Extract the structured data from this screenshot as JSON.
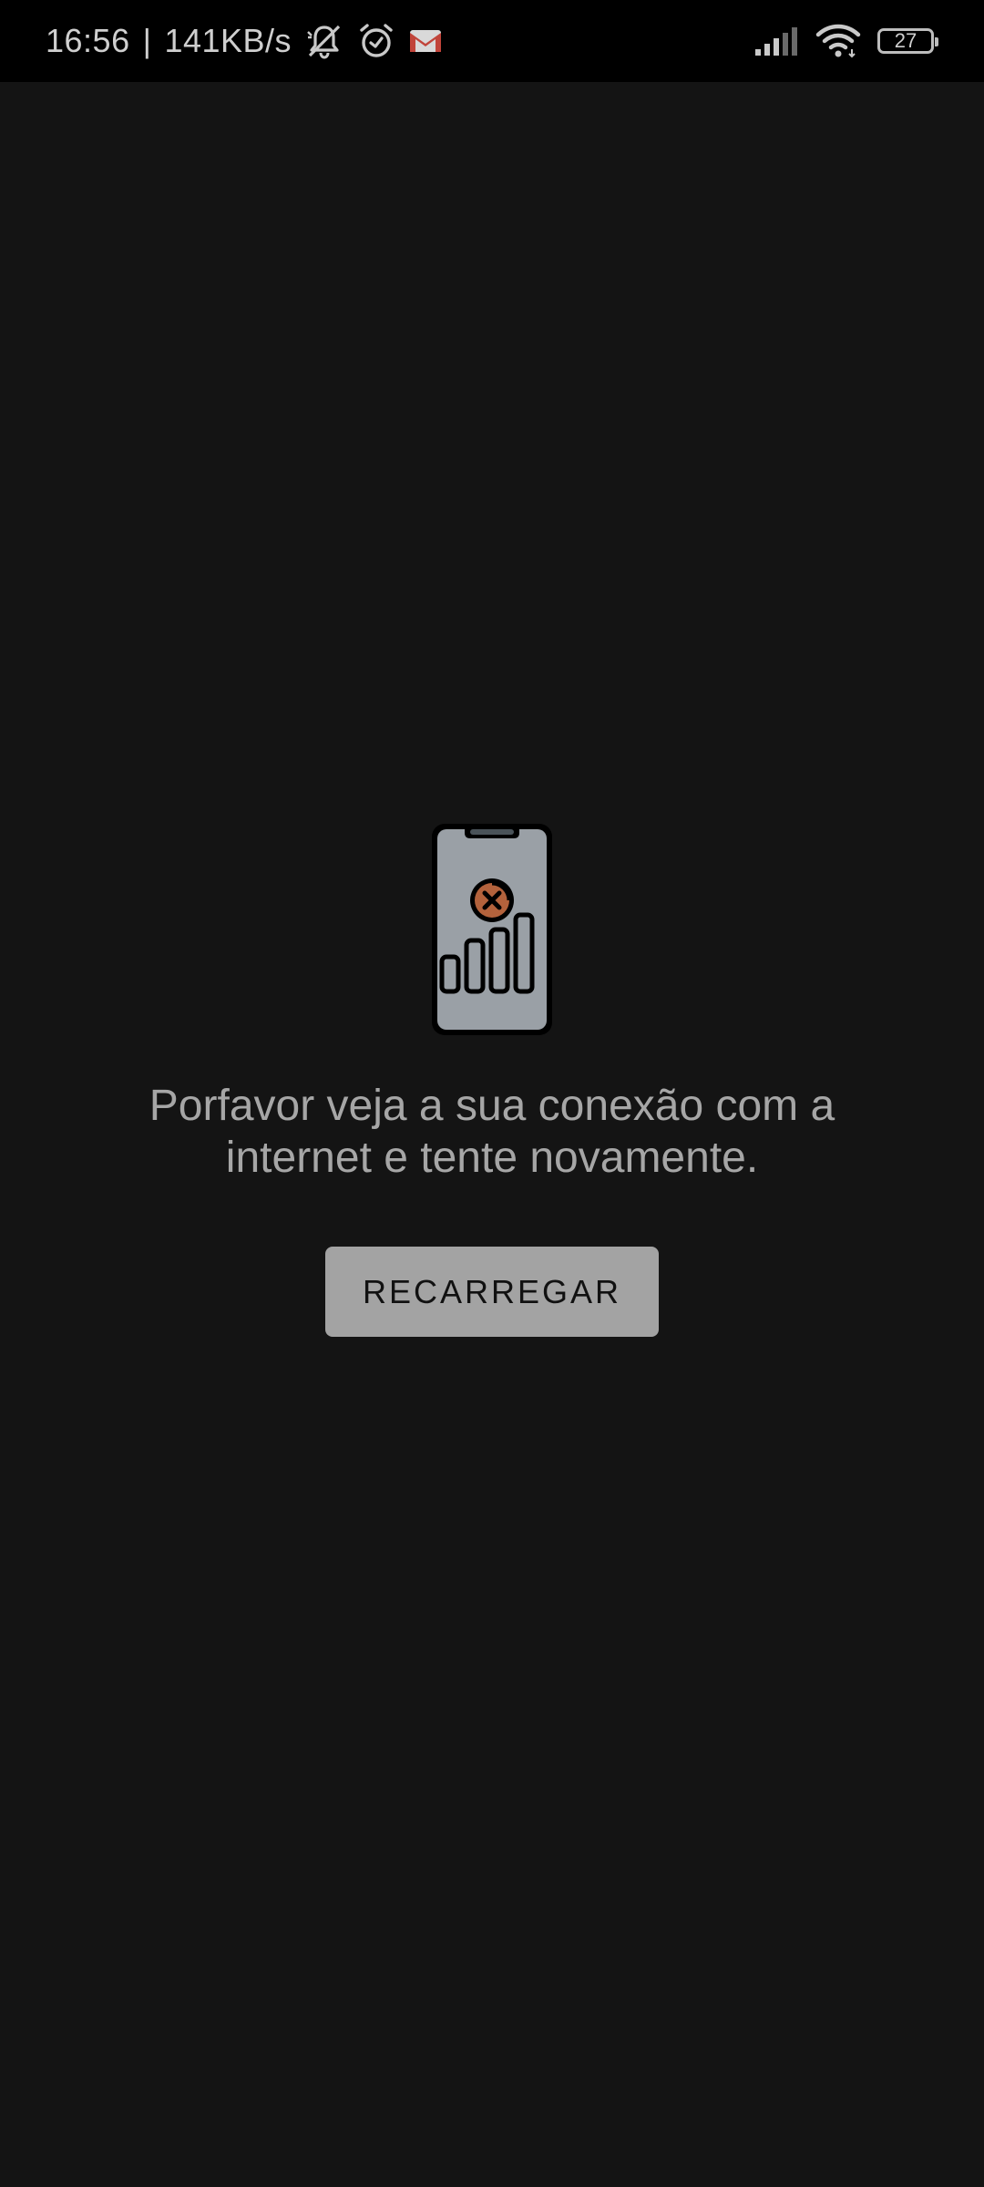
{
  "status_bar": {
    "time": "16:56",
    "separator": "|",
    "net_speed": "141KB/s",
    "battery_level": "27",
    "icons": [
      "muted-bell-icon",
      "alarm-icon",
      "gmail-icon",
      "signal-icon",
      "wifi-icon",
      "battery-icon"
    ]
  },
  "error_screen": {
    "illustration": "phone-no-signal-icon",
    "message": "Porfavor veja a sua conexão com a internet e tente novamente.",
    "reload_label": "RECARREGAR"
  },
  "colors": {
    "background": "#141414",
    "status_bar": "#000000",
    "text": "#a6a6a6",
    "button": "#a3a3a3",
    "error_accent": "#b3623c"
  }
}
